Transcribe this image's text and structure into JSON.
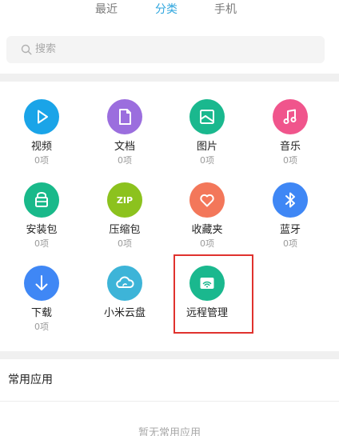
{
  "tabs": [
    {
      "label": "最近"
    },
    {
      "label": "分类"
    },
    {
      "label": "手机"
    }
  ],
  "search": {
    "placeholder": "搜索",
    "icon": "search-icon"
  },
  "categories": [
    {
      "name": "视频",
      "count": "0项",
      "color": "#1aa4e8",
      "icon": "play-icon"
    },
    {
      "name": "文档",
      "count": "0项",
      "color": "#9b6ede",
      "icon": "document-icon"
    },
    {
      "name": "图片",
      "count": "0项",
      "color": "#1ab88e",
      "icon": "image-icon"
    },
    {
      "name": "音乐",
      "count": "0项",
      "color": "#f0558c",
      "icon": "music-note-icon"
    },
    {
      "name": "安装包",
      "count": "0项",
      "color": "#19b98a",
      "icon": "package-icon"
    },
    {
      "name": "压缩包",
      "count": "0项",
      "color": "#8cc21e",
      "icon": "zip-icon",
      "icon_text": "ZIP"
    },
    {
      "name": "收藏夹",
      "count": "0项",
      "color": "#f3775a",
      "icon": "heart-icon"
    },
    {
      "name": "蓝牙",
      "count": "0项",
      "color": "#3f87f5",
      "icon": "bluetooth-icon"
    },
    {
      "name": "下载",
      "count": "0项",
      "color": "#3f87f5",
      "icon": "download-icon"
    },
    {
      "name": "小米云盘",
      "count": "",
      "color": "#3db4d8",
      "icon": "cloud-icon"
    },
    {
      "name": "远程管理",
      "count": "",
      "color": "#1ab88e",
      "icon": "remote-wifi-icon"
    }
  ],
  "common_apps": {
    "title": "常用应用",
    "empty_text": "暂无常用应用"
  },
  "colors": {
    "tab_active": "#2fa6de",
    "tab_inactive": "#7a7a7a",
    "highlight_border": "#e0322e"
  }
}
